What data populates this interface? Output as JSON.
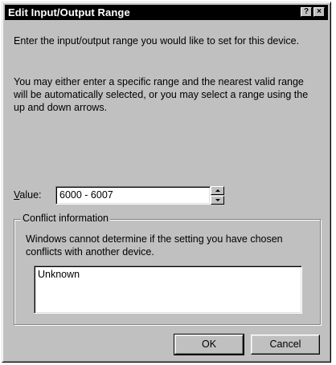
{
  "window": {
    "title": "Edit Input/Output Range",
    "help_button": "?",
    "close_button": "×"
  },
  "instructions": {
    "line1": "Enter the input/output range you would like to set for this device.",
    "line2": "You may either enter a specific range and the nearest valid range will be automatically selected, or you may select a range using the up and down arrows."
  },
  "value": {
    "label_mnemonic": "V",
    "label_rest": "alue:",
    "current": "6000 - 6007"
  },
  "conflict": {
    "group_label": "Conflict information",
    "description": "Windows cannot determine if the setting you have chosen conflicts with another device.",
    "result": "Unknown"
  },
  "buttons": {
    "ok": "OK",
    "cancel": "Cancel"
  }
}
